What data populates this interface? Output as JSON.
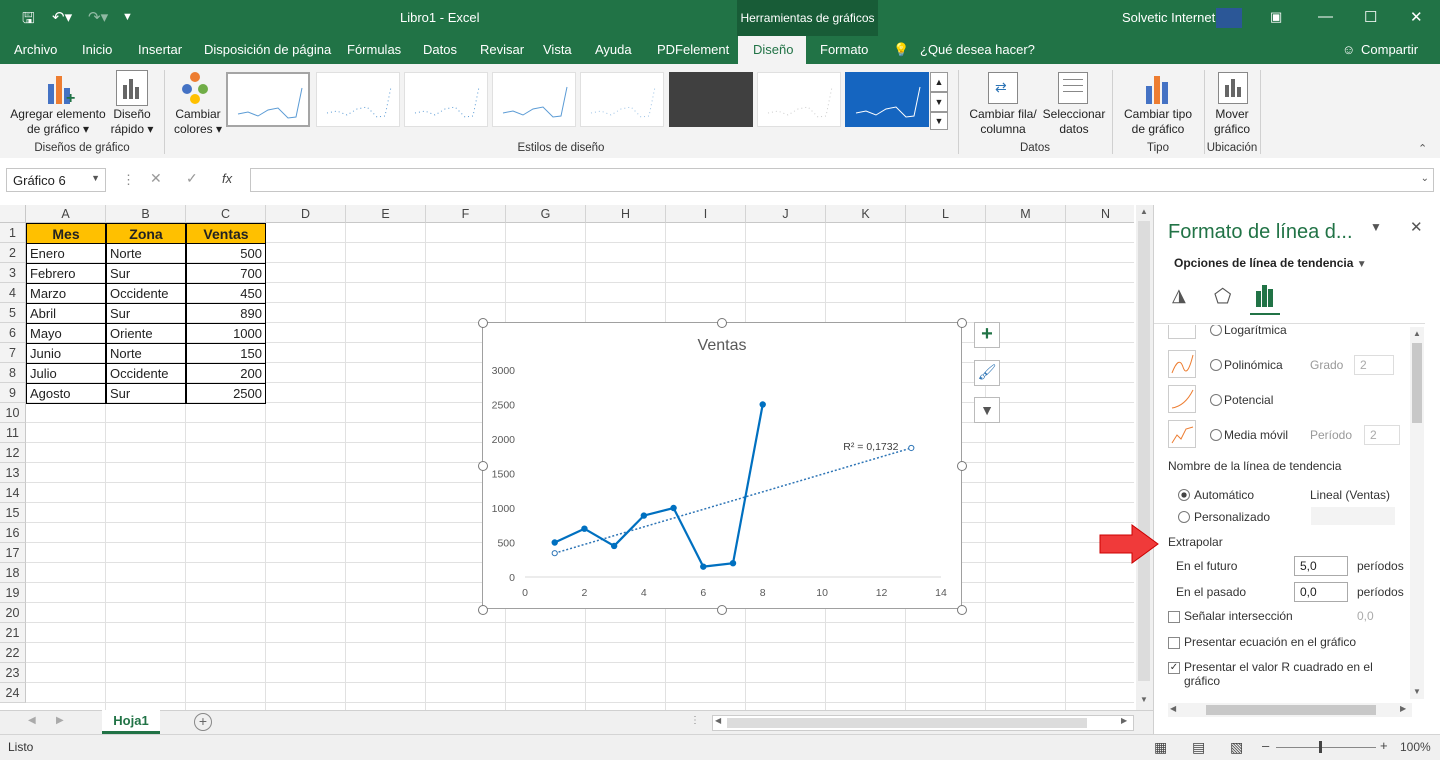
{
  "window": {
    "title": "Libro1  -  Excel",
    "context_tab": "Herramientas de gráficos",
    "user": "Solvetic Internet"
  },
  "tabs": [
    "Archivo",
    "Inicio",
    "Insertar",
    "Disposición de página",
    "Fórmulas",
    "Datos",
    "Revisar",
    "Vista",
    "Ayuda",
    "PDFelement",
    "Diseño",
    "Formato"
  ],
  "tell_me": "¿Qué desea hacer?",
  "share": "Compartir",
  "ribbon": {
    "add_element": [
      "Agregar elemento",
      "de gráfico"
    ],
    "quick_layout": [
      "Diseño",
      "rápido"
    ],
    "change_colors": [
      "Cambiar",
      "colores"
    ],
    "switch_row_col": [
      "Cambiar fila/",
      "columna"
    ],
    "select_data": [
      "Seleccionar",
      "datos"
    ],
    "change_type": [
      "Cambiar tipo",
      "de gráfico"
    ],
    "move_chart": [
      "Mover",
      "gráfico"
    ],
    "groups": {
      "chart_layouts": "Diseños de gráfico",
      "chart_styles": "Estilos de diseño",
      "data": "Datos",
      "type": "Tipo",
      "location": "Ubicación"
    }
  },
  "namebox": "Gráfico 6",
  "fx": "fx",
  "columns": [
    "A",
    "B",
    "C",
    "D",
    "E",
    "F",
    "G",
    "H",
    "I",
    "J",
    "K",
    "L",
    "M",
    "N"
  ],
  "rows": [
    "1",
    "2",
    "3",
    "4",
    "5",
    "6",
    "7",
    "8",
    "9",
    "10",
    "11",
    "12",
    "13",
    "14",
    "15",
    "16",
    "17",
    "18",
    "19",
    "20",
    "21",
    "22",
    "23",
    "24"
  ],
  "table": {
    "headers": [
      "Mes",
      "Zona",
      "Ventas"
    ],
    "rows": [
      [
        "Enero",
        "Norte",
        "500"
      ],
      [
        "Febrero",
        "Sur",
        "700"
      ],
      [
        "Marzo",
        "Occidente",
        "450"
      ],
      [
        "Abril",
        "Sur",
        "890"
      ],
      [
        "Mayo",
        "Oriente",
        "1000"
      ],
      [
        "Junio",
        "Norte",
        "150"
      ],
      [
        "Julio",
        "Occidente",
        "200"
      ],
      [
        "Agosto",
        "Sur",
        "2500"
      ]
    ]
  },
  "chart_data": {
    "type": "scatter",
    "title": "Ventas",
    "x": [
      1,
      2,
      3,
      4,
      5,
      6,
      7,
      8
    ],
    "y": [
      500,
      700,
      450,
      890,
      1000,
      150,
      200,
      2500
    ],
    "xlim": [
      0,
      14
    ],
    "ylim": [
      0,
      3000
    ],
    "xticks": [
      "0",
      "2",
      "4",
      "6",
      "8",
      "10",
      "12",
      "14"
    ],
    "yticks": [
      "0",
      "500",
      "1000",
      "1500",
      "2000",
      "2500",
      "3000"
    ],
    "trendline": {
      "type": "linear",
      "x": [
        1,
        13
      ],
      "y": [
        345,
        1870
      ],
      "r2_label": "R² = 0,1732"
    },
    "series_color": "#0070c0",
    "grid": false,
    "legend": "none"
  },
  "panel": {
    "title": "Formato de línea d...",
    "subtitle": "Opciones de línea de tendencia",
    "options": {
      "logaritmica": "Logarítmica",
      "polinomica": "Polinómica",
      "potencial": "Potencial",
      "media_movil": "Media móvil",
      "grado_label": "Grado",
      "grado_value": "2",
      "periodo_label": "Período",
      "periodo_value": "2"
    },
    "name_section": "Nombre de la línea de tendencia",
    "automatico": "Automático",
    "automatico_value": "Lineal (Ventas)",
    "personalizado": "Personalizado",
    "extrapolar": "Extrapolar",
    "futuro_label": "En el futuro",
    "futuro_value": "5,0",
    "pasado_label": "En el pasado",
    "pasado_value": "0,0",
    "periodos": "períodos",
    "interseccion": "Señalar intersección",
    "interseccion_value": "0,0",
    "ecuacion": "Presentar ecuación en el gráfico",
    "r2_label": [
      "Presentar el valor R cuadrado en el",
      "gráfico"
    ]
  },
  "sheet_tab": "Hoja1",
  "status": "Listo",
  "zoom": "100%"
}
